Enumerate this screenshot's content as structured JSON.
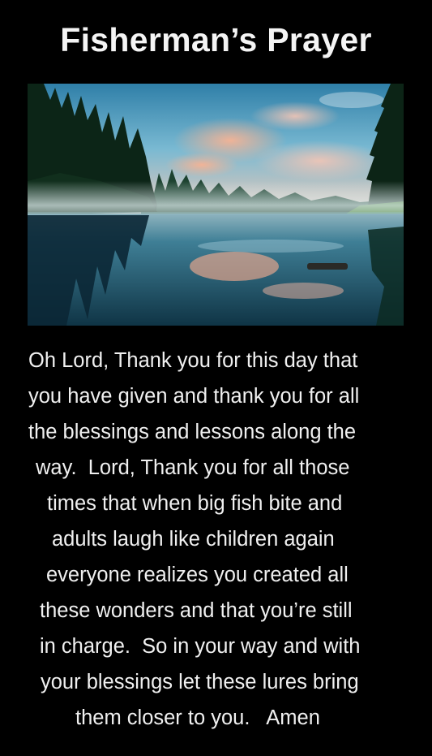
{
  "title": "Fisherman’s Prayer",
  "photo": {
    "description_icon": "lake-landscape-image",
    "colors": {
      "sky_top": "#3f8fb5",
      "sky_mid": "#7fbfd6",
      "cloud_pink": "#f2a98c",
      "water_dark": "#123b4a",
      "water_mid": "#2d6f86",
      "forest": "#0e2a1a",
      "grass": "#3f7a2c",
      "mist": "#cfe3e6"
    }
  },
  "prayer_lines": [
    "Oh Lord, Thank you for this day that",
    "you have given and thank you for all",
    "the blessings and lessons along the",
    "way.  Lord, Thank you for all those",
    "times that when big fish bite and",
    "adults laugh like children again",
    "everyone realizes you created all",
    "these wonders and that you’re still",
    "in charge.  So in your way and with",
    "your blessings let these lures bring",
    "them closer to you.   Amen"
  ]
}
